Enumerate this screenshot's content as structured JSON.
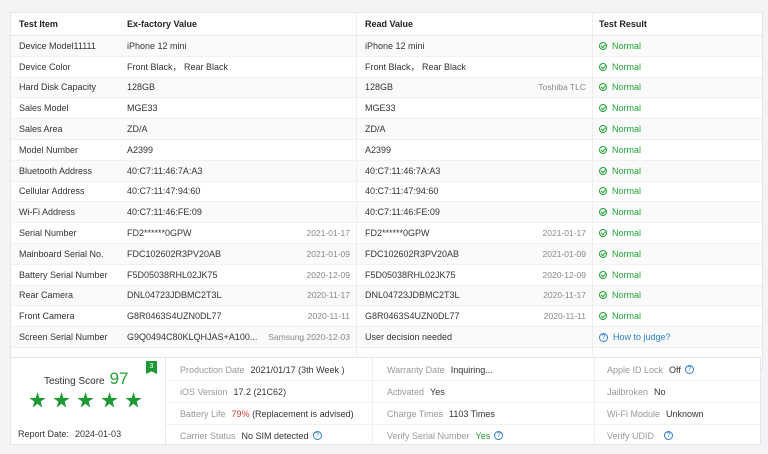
{
  "headers": {
    "item": "Test Item",
    "factory": "Ex-factory Value",
    "read": "Read Value",
    "result": "Test Result"
  },
  "rows": [
    {
      "item": "Device Model11111",
      "factory": "iPhone 12 mini",
      "factory_sub": "",
      "read": "iPhone 12 mini",
      "read_sub": "",
      "result": "Normal",
      "status": "ok"
    },
    {
      "item": "Device Color",
      "factory": "Front Black， Rear Black",
      "factory_sub": "",
      "read": "Front Black， Rear Black",
      "read_sub": "",
      "result": "Normal",
      "status": "ok"
    },
    {
      "item": "Hard Disk Capacity",
      "factory": "128GB",
      "factory_sub": "",
      "read": "128GB",
      "read_sub": "Toshiba TLC",
      "result": "Normal",
      "status": "ok"
    },
    {
      "item": "Sales Model",
      "factory": "MGE33",
      "factory_sub": "",
      "read": "MGE33",
      "read_sub": "",
      "result": "Normal",
      "status": "ok"
    },
    {
      "item": "Sales Area",
      "factory": "ZD/A",
      "factory_sub": "",
      "read": "ZD/A",
      "read_sub": "",
      "result": "Normal",
      "status": "ok"
    },
    {
      "item": "Model Number",
      "factory": "A2399",
      "factory_sub": "",
      "read": "A2399",
      "read_sub": "",
      "result": "Normal",
      "status": "ok"
    },
    {
      "item": "Bluetooth Address",
      "factory": "40:C7:11:46:7A:A3",
      "factory_sub": "",
      "read": "40:C7:11:46:7A:A3",
      "read_sub": "",
      "result": "Normal",
      "status": "ok"
    },
    {
      "item": "Cellular Address",
      "factory": "40:C7:11:47:94:60",
      "factory_sub": "",
      "read": "40:C7:11:47:94:60",
      "read_sub": "",
      "result": "Normal",
      "status": "ok"
    },
    {
      "item": "Wi-Fi Address",
      "factory": "40:C7:11:46:FE:09",
      "factory_sub": "",
      "read": "40:C7:11:46:FE:09",
      "read_sub": "",
      "result": "Normal",
      "status": "ok"
    },
    {
      "item": "Serial Number",
      "factory": "FD2******0GPW",
      "factory_sub": "2021-01-17",
      "read": "FD2******0GPW",
      "read_sub": "2021-01-17",
      "result": "Normal",
      "status": "ok"
    },
    {
      "item": "Mainboard Serial No.",
      "factory": "FDC102602R3PV20AB",
      "factory_sub": "2021-01-09",
      "read": "FDC102602R3PV20AB",
      "read_sub": "2021-01-09",
      "result": "Normal",
      "status": "ok"
    },
    {
      "item": "Battery Serial Number",
      "factory": "F5D05038RHL02JK75",
      "factory_sub": "2020-12-09",
      "read": "F5D05038RHL02JK75",
      "read_sub": "2020-12-09",
      "result": "Normal",
      "status": "ok"
    },
    {
      "item": "Rear Camera",
      "factory": "DNL04723JDBMC2T3L",
      "factory_sub": "2020-11-17",
      "read": "DNL04723JDBMC2T3L",
      "read_sub": "2020-11-17",
      "result": "Normal",
      "status": "ok"
    },
    {
      "item": "Front Camera",
      "factory": "G8R0463S4UZN0DL77",
      "factory_sub": "2020-11-11",
      "read": "G8R0463S4UZN0DL77",
      "read_sub": "2020-11-11",
      "result": "Normal",
      "status": "ok"
    },
    {
      "item": "Screen Serial Number",
      "factory": "G9Q0494C80KLQHJAS+A100...",
      "factory_sub": "Samsung 2020-12-03",
      "read": "User decision needed",
      "read_sub": "",
      "result": "How to judge?",
      "status": "help"
    }
  ],
  "score": {
    "label": "Testing Score",
    "value": "97",
    "badge": "3",
    "stars": 5
  },
  "report": {
    "label": "Report Date:",
    "value": "2024-01-03"
  },
  "info": {
    "production_date": {
      "k": "Production Date",
      "v": "2021/01/17 (3th Week )"
    },
    "ios_version": {
      "k": "iOS Version",
      "v": "17.2 (21C62)"
    },
    "battery_life": {
      "k": "Battery Life",
      "pct": "79%",
      "note": "(Replacement is advised)"
    },
    "carrier_status": {
      "k": "Carrier Status",
      "v": "No SIM detected"
    },
    "warranty_date": {
      "k": "Warranty Date",
      "v": "Inquiring..."
    },
    "activated": {
      "k": "Activated",
      "v": "Yes"
    },
    "charge_times": {
      "k": "Charge Times",
      "v": "1103 Times"
    },
    "verify_serial": {
      "k": "Verify Serial Number",
      "v": "Yes"
    },
    "apple_id_lock": {
      "k": "Apple ID Lock",
      "v": "Off"
    },
    "jailbroken": {
      "k": "Jailbroken",
      "v": "No"
    },
    "wifi_module": {
      "k": "Wi-Fi Module",
      "v": "Unknown"
    },
    "verify_udid": {
      "k": "Verify UDID",
      "v": ""
    }
  },
  "colors": {
    "ok": "#21a336",
    "link": "#2d7fd1",
    "warn": "#e03b3b"
  },
  "icons": {
    "ok": "check-circle-icon",
    "help": "question-circle-icon",
    "star": "star-icon"
  }
}
